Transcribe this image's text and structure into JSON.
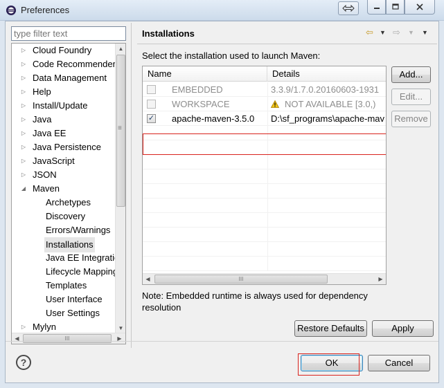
{
  "window": {
    "title": "Preferences"
  },
  "filter": {
    "placeholder": "type filter text"
  },
  "tree": {
    "items": [
      {
        "label": "Cloud Foundry",
        "level": 0,
        "expander": "closed"
      },
      {
        "label": "Code Recommenders",
        "level": 0,
        "expander": "closed"
      },
      {
        "label": "Data Management",
        "level": 0,
        "expander": "closed"
      },
      {
        "label": "Help",
        "level": 0,
        "expander": "closed"
      },
      {
        "label": "Install/Update",
        "level": 0,
        "expander": "closed"
      },
      {
        "label": "Java",
        "level": 0,
        "expander": "closed"
      },
      {
        "label": "Java EE",
        "level": 0,
        "expander": "closed"
      },
      {
        "label": "Java Persistence",
        "level": 0,
        "expander": "closed"
      },
      {
        "label": "JavaScript",
        "level": 0,
        "expander": "closed"
      },
      {
        "label": "JSON",
        "level": 0,
        "expander": "closed"
      },
      {
        "label": "Maven",
        "level": 0,
        "expander": "open"
      },
      {
        "label": "Archetypes",
        "level": 1,
        "expander": "none"
      },
      {
        "label": "Discovery",
        "level": 1,
        "expander": "none"
      },
      {
        "label": "Errors/Warnings",
        "level": 1,
        "expander": "none"
      },
      {
        "label": "Installations",
        "level": 1,
        "expander": "none",
        "selected": true
      },
      {
        "label": "Java EE Integration",
        "level": 1,
        "expander": "none"
      },
      {
        "label": "Lifecycle Mapping",
        "level": 1,
        "expander": "none"
      },
      {
        "label": "Templates",
        "level": 1,
        "expander": "none"
      },
      {
        "label": "User Interface",
        "level": 1,
        "expander": "none"
      },
      {
        "label": "User Settings",
        "level": 1,
        "expander": "none"
      },
      {
        "label": "Mylyn",
        "level": 0,
        "expander": "closed"
      }
    ]
  },
  "page": {
    "title": "Installations",
    "description": "Select the installation used to launch Maven:",
    "note": "Note: Embedded runtime is always used for dependency resolution"
  },
  "table": {
    "columns": {
      "name": "Name",
      "details": "Details"
    },
    "rows": [
      {
        "name": "EMBEDDED",
        "details": "3.3.9/1.7.0.20160603-1931",
        "checked": false,
        "enabled": false,
        "warning": false
      },
      {
        "name": "WORKSPACE",
        "details": "NOT AVAILABLE [3.0,)",
        "checked": false,
        "enabled": false,
        "warning": true
      },
      {
        "name": "apache-maven-3.5.0",
        "details": "D:\\sf_programs\\apache-mav",
        "checked": true,
        "enabled": true,
        "warning": false
      }
    ]
  },
  "buttons": {
    "add": "Add...",
    "edit": "Edit...",
    "remove": "Remove",
    "restore_defaults": "Restore Defaults",
    "apply": "Apply",
    "ok": "OK",
    "cancel": "Cancel"
  },
  "icons": {
    "help": "?",
    "back": "⇦",
    "forward": "⇨",
    "dropdown": "▼",
    "scroll_grip": "≡",
    "hscroll_grip": "III",
    "checkmark": "✓"
  },
  "colors": {
    "highlight": "#d9221c",
    "warning": "#f0c419"
  }
}
